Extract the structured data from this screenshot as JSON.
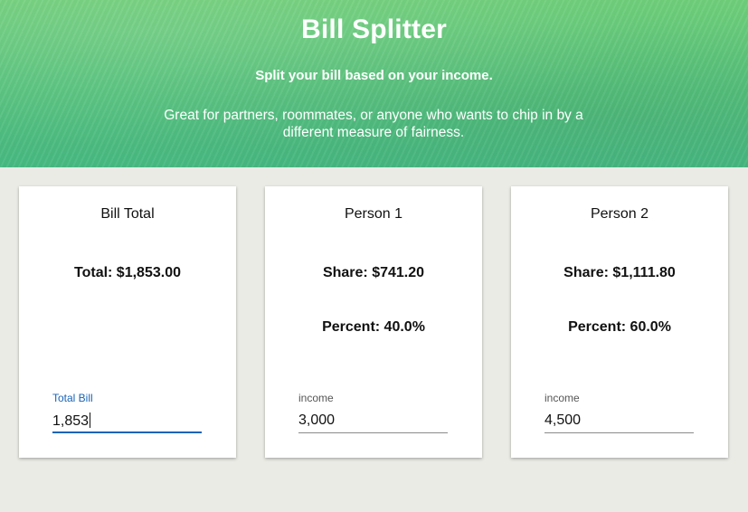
{
  "header": {
    "title": "Bill Splitter",
    "subtitle": "Split your bill based on your income.",
    "description": "Great for partners, roommates, or anyone who wants to chip in by a different measure of fairness."
  },
  "cards": {
    "bill": {
      "title": "Bill Total",
      "total_text": "Total: $1,853.00",
      "field_label": "Total Bill",
      "field_value": "1,853"
    },
    "person1": {
      "title": "Person 1",
      "share_text": "Share: $741.20",
      "percent_text": "Percent: 40.0%",
      "field_label": "income",
      "field_value": "3,000"
    },
    "person2": {
      "title": "Person 2",
      "share_text": "Share: $1,111.80",
      "percent_text": "Percent: 60.0%",
      "field_label": "income",
      "field_value": "4,500"
    }
  },
  "colors": {
    "header_green": "#55c27d",
    "accent_blue": "#1a63b8",
    "page_background": "#ebebe6"
  }
}
